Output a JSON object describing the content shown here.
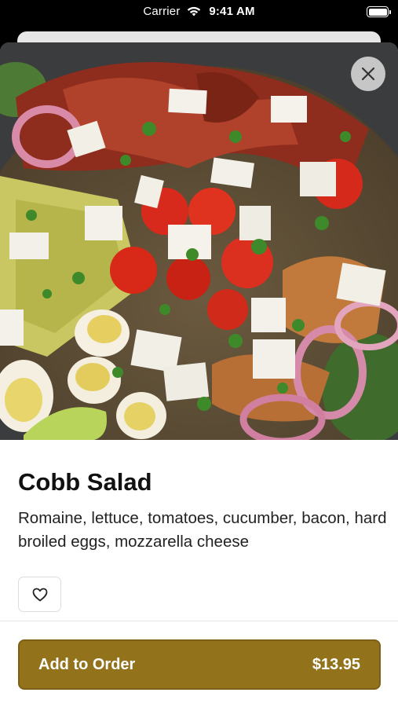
{
  "status_bar": {
    "carrier": "Carrier",
    "time": "9:41 AM"
  },
  "item": {
    "name": "Cobb Salad",
    "description": "Romaine, lettuce, tomatoes, cucumber, bacon, hard broiled eggs, mozzarella cheese",
    "image_icon": "salad-photo"
  },
  "actions": {
    "close_icon": "close-icon",
    "favorite_icon": "heart-icon",
    "add_to_order_label": "Add to Order",
    "price": "$13.95"
  },
  "colors": {
    "accent": "#93721c",
    "close_bg": "#d2d2d2"
  }
}
